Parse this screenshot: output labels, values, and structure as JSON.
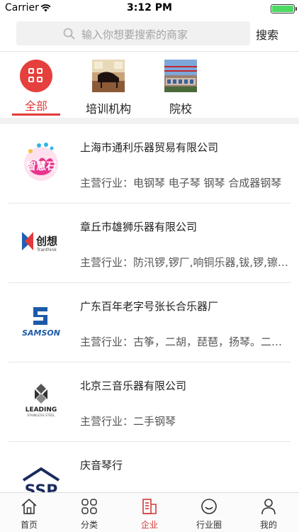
{
  "status_bar": {
    "carrier": "Carrier",
    "time": "3:12 PM"
  },
  "search": {
    "placeholder": "输入你想要搜索的商家",
    "button_label": "搜索"
  },
  "categories": [
    {
      "label": "全部",
      "active": true
    },
    {
      "label": "培训机构",
      "active": false
    },
    {
      "label": "院校",
      "active": false
    }
  ],
  "companies": [
    {
      "name": "上海市通利乐器贸易有限公司",
      "desc": "主营行业：电钢琴 电子琴 钢琴 合成器钢琴",
      "logo": "zhiqin-shi-logo"
    },
    {
      "name": "章丘市雄狮乐器有限公司",
      "desc": "主营行业：防汛锣,锣厂,响铜乐器,钹,锣,镲,打击乐器",
      "logo": "tranthink-logo",
      "logo_text": "创想",
      "logo_sub": "Tranthink"
    },
    {
      "name": "广东百年老字号张长合乐器厂",
      "desc": "主营行业：古筝，二胡，琵琶，扬琴。二胡厂家",
      "logo": "samson-logo",
      "logo_text": "SAMSON"
    },
    {
      "name": "北京三音乐器有限公司",
      "desc": "主营行业：二手钢琴",
      "logo": "leading-logo",
      "logo_text": "LEADING",
      "logo_sub": "STAINLESS STEEL"
    },
    {
      "name": "庆音琴行",
      "desc": "",
      "logo": "ssp-logo",
      "logo_text": "SSP"
    }
  ],
  "tabbar": [
    {
      "label": "首页",
      "icon": "home-icon",
      "active": false
    },
    {
      "label": "分类",
      "icon": "category-icon",
      "active": false
    },
    {
      "label": "企业",
      "icon": "company-icon",
      "active": true
    },
    {
      "label": "行业圈",
      "icon": "circle-icon",
      "active": false
    },
    {
      "label": "我的",
      "icon": "profile-icon",
      "active": false
    }
  ],
  "colors": {
    "accent": "#e23c3c",
    "battery": "#4cd964",
    "separator": "#e6e6e6"
  }
}
